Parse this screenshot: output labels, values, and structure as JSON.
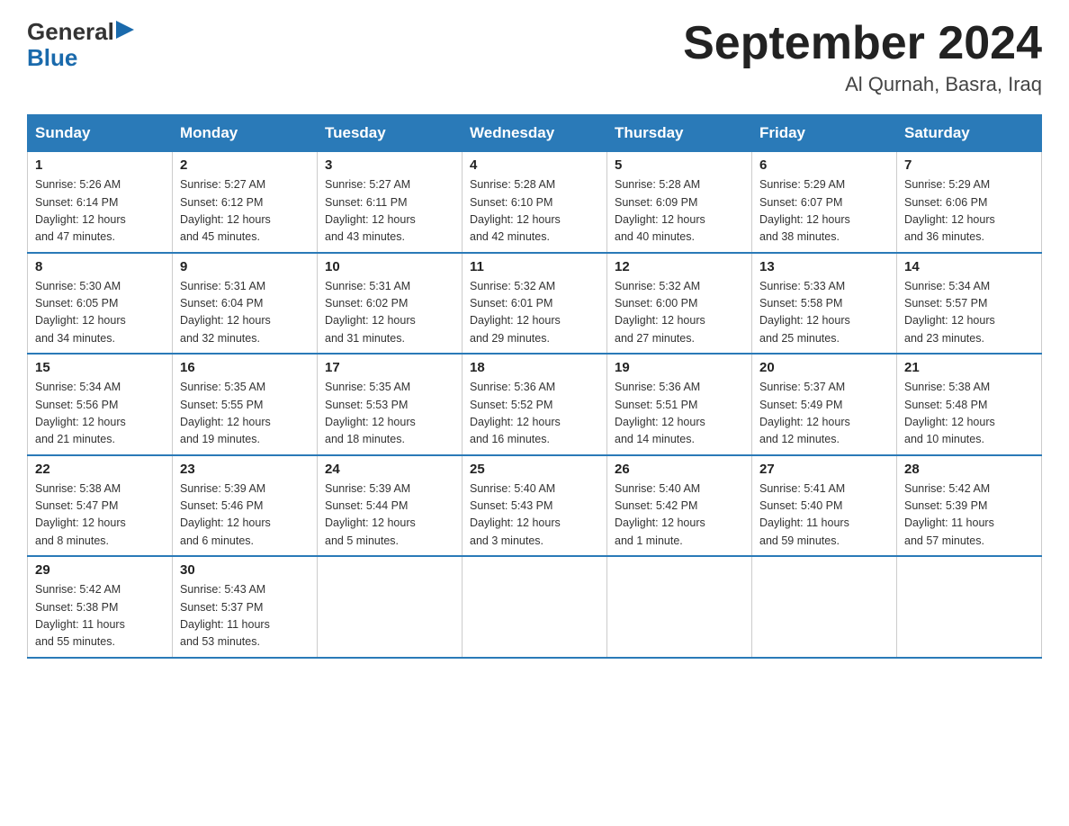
{
  "logo": {
    "text_general": "General",
    "text_blue": "Blue",
    "triangle_char": "▶"
  },
  "title": "September 2024",
  "subtitle": "Al Qurnah, Basra, Iraq",
  "days_of_week": [
    "Sunday",
    "Monday",
    "Tuesday",
    "Wednesday",
    "Thursday",
    "Friday",
    "Saturday"
  ],
  "weeks": [
    [
      {
        "day": "1",
        "info": "Sunrise: 5:26 AM\nSunset: 6:14 PM\nDaylight: 12 hours\nand 47 minutes."
      },
      {
        "day": "2",
        "info": "Sunrise: 5:27 AM\nSunset: 6:12 PM\nDaylight: 12 hours\nand 45 minutes."
      },
      {
        "day": "3",
        "info": "Sunrise: 5:27 AM\nSunset: 6:11 PM\nDaylight: 12 hours\nand 43 minutes."
      },
      {
        "day": "4",
        "info": "Sunrise: 5:28 AM\nSunset: 6:10 PM\nDaylight: 12 hours\nand 42 minutes."
      },
      {
        "day": "5",
        "info": "Sunrise: 5:28 AM\nSunset: 6:09 PM\nDaylight: 12 hours\nand 40 minutes."
      },
      {
        "day": "6",
        "info": "Sunrise: 5:29 AM\nSunset: 6:07 PM\nDaylight: 12 hours\nand 38 minutes."
      },
      {
        "day": "7",
        "info": "Sunrise: 5:29 AM\nSunset: 6:06 PM\nDaylight: 12 hours\nand 36 minutes."
      }
    ],
    [
      {
        "day": "8",
        "info": "Sunrise: 5:30 AM\nSunset: 6:05 PM\nDaylight: 12 hours\nand 34 minutes."
      },
      {
        "day": "9",
        "info": "Sunrise: 5:31 AM\nSunset: 6:04 PM\nDaylight: 12 hours\nand 32 minutes."
      },
      {
        "day": "10",
        "info": "Sunrise: 5:31 AM\nSunset: 6:02 PM\nDaylight: 12 hours\nand 31 minutes."
      },
      {
        "day": "11",
        "info": "Sunrise: 5:32 AM\nSunset: 6:01 PM\nDaylight: 12 hours\nand 29 minutes."
      },
      {
        "day": "12",
        "info": "Sunrise: 5:32 AM\nSunset: 6:00 PM\nDaylight: 12 hours\nand 27 minutes."
      },
      {
        "day": "13",
        "info": "Sunrise: 5:33 AM\nSunset: 5:58 PM\nDaylight: 12 hours\nand 25 minutes."
      },
      {
        "day": "14",
        "info": "Sunrise: 5:34 AM\nSunset: 5:57 PM\nDaylight: 12 hours\nand 23 minutes."
      }
    ],
    [
      {
        "day": "15",
        "info": "Sunrise: 5:34 AM\nSunset: 5:56 PM\nDaylight: 12 hours\nand 21 minutes."
      },
      {
        "day": "16",
        "info": "Sunrise: 5:35 AM\nSunset: 5:55 PM\nDaylight: 12 hours\nand 19 minutes."
      },
      {
        "day": "17",
        "info": "Sunrise: 5:35 AM\nSunset: 5:53 PM\nDaylight: 12 hours\nand 18 minutes."
      },
      {
        "day": "18",
        "info": "Sunrise: 5:36 AM\nSunset: 5:52 PM\nDaylight: 12 hours\nand 16 minutes."
      },
      {
        "day": "19",
        "info": "Sunrise: 5:36 AM\nSunset: 5:51 PM\nDaylight: 12 hours\nand 14 minutes."
      },
      {
        "day": "20",
        "info": "Sunrise: 5:37 AM\nSunset: 5:49 PM\nDaylight: 12 hours\nand 12 minutes."
      },
      {
        "day": "21",
        "info": "Sunrise: 5:38 AM\nSunset: 5:48 PM\nDaylight: 12 hours\nand 10 minutes."
      }
    ],
    [
      {
        "day": "22",
        "info": "Sunrise: 5:38 AM\nSunset: 5:47 PM\nDaylight: 12 hours\nand 8 minutes."
      },
      {
        "day": "23",
        "info": "Sunrise: 5:39 AM\nSunset: 5:46 PM\nDaylight: 12 hours\nand 6 minutes."
      },
      {
        "day": "24",
        "info": "Sunrise: 5:39 AM\nSunset: 5:44 PM\nDaylight: 12 hours\nand 5 minutes."
      },
      {
        "day": "25",
        "info": "Sunrise: 5:40 AM\nSunset: 5:43 PM\nDaylight: 12 hours\nand 3 minutes."
      },
      {
        "day": "26",
        "info": "Sunrise: 5:40 AM\nSunset: 5:42 PM\nDaylight: 12 hours\nand 1 minute."
      },
      {
        "day": "27",
        "info": "Sunrise: 5:41 AM\nSunset: 5:40 PM\nDaylight: 11 hours\nand 59 minutes."
      },
      {
        "day": "28",
        "info": "Sunrise: 5:42 AM\nSunset: 5:39 PM\nDaylight: 11 hours\nand 57 minutes."
      }
    ],
    [
      {
        "day": "29",
        "info": "Sunrise: 5:42 AM\nSunset: 5:38 PM\nDaylight: 11 hours\nand 55 minutes."
      },
      {
        "day": "30",
        "info": "Sunrise: 5:43 AM\nSunset: 5:37 PM\nDaylight: 11 hours\nand 53 minutes."
      },
      {
        "day": "",
        "info": ""
      },
      {
        "day": "",
        "info": ""
      },
      {
        "day": "",
        "info": ""
      },
      {
        "day": "",
        "info": ""
      },
      {
        "day": "",
        "info": ""
      }
    ]
  ]
}
